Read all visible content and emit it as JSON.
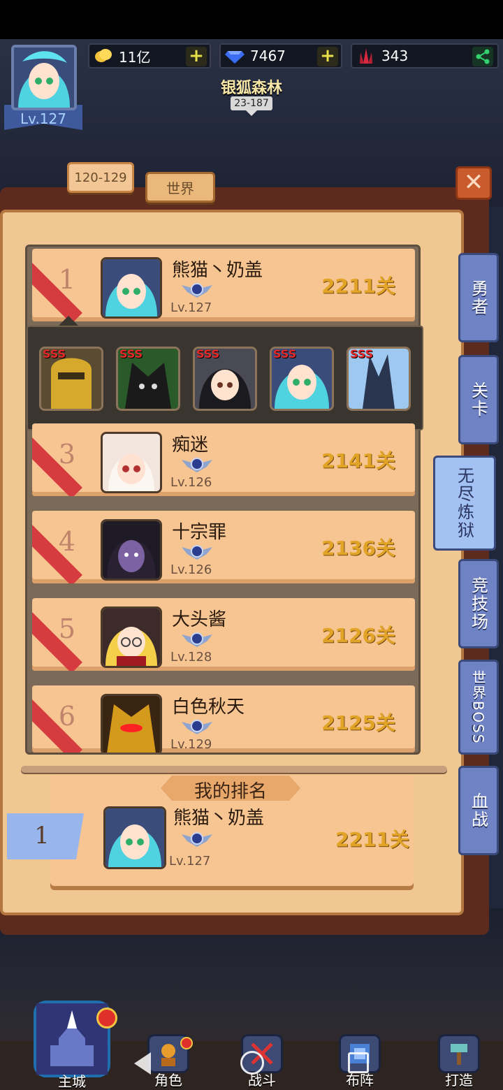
{
  "hud": {
    "player_level": "Lv.127",
    "gold": "11亿",
    "diamonds": "7467",
    "crystal": "343",
    "stage_name": "银狐森林",
    "stage_code": "23-187"
  },
  "tabs": [
    {
      "label": "120-129",
      "active": true
    },
    {
      "label": "世界",
      "active": false
    }
  ],
  "ranking": [
    {
      "rank": "1",
      "name": "熊猫丶奶盖",
      "level": "Lv.127",
      "score": "2211关"
    },
    {
      "rank": "3",
      "name": "痴迷",
      "level": "Lv.126",
      "score": "2141关"
    },
    {
      "rank": "4",
      "name": "十宗罪",
      "level": "Lv.126",
      "score": "2136关"
    },
    {
      "rank": "5",
      "name": "大头酱",
      "level": "Lv.128",
      "score": "2126关"
    },
    {
      "rank": "6",
      "name": "白色秋天",
      "level": "Lv.129",
      "score": "2125关"
    }
  ],
  "team_popup": {
    "heroes": [
      {
        "grade": "SSS",
        "icon": "golden-knight-hero"
      },
      {
        "grade": "SSS",
        "icon": "dark-beast-hero"
      },
      {
        "grade": "SSS",
        "icon": "black-hair-girl-hero"
      },
      {
        "grade": "SSS",
        "icon": "elf-girl-hero"
      },
      {
        "grade": "SSS",
        "icon": "ice-tree-hero"
      }
    ]
  },
  "side_menu": [
    {
      "label": "勇者",
      "active": false
    },
    {
      "label": "关卡",
      "active": false
    },
    {
      "label": "无尽炼狱",
      "active": true
    },
    {
      "label": "竞技场",
      "active": false
    },
    {
      "label": "世界BOSS",
      "active": false
    },
    {
      "label": "血战",
      "active": false
    }
  ],
  "my_ranking": {
    "title": "我的排名",
    "rank": "1",
    "name": "熊猫丶奶盖",
    "level": "Lv.127",
    "score": "2211关"
  },
  "bottom_nav": [
    {
      "label": "主城"
    },
    {
      "label": "角色"
    },
    {
      "label": "战斗"
    },
    {
      "label": "布阵"
    },
    {
      "label": "打造"
    }
  ],
  "colors": {
    "board": "#f0c691",
    "row": "#f6c591",
    "ribbon": "#d53b3f",
    "score": "#e2a426",
    "side_tab": "#6f82c4",
    "side_tab_active": "#a3c2f3"
  }
}
